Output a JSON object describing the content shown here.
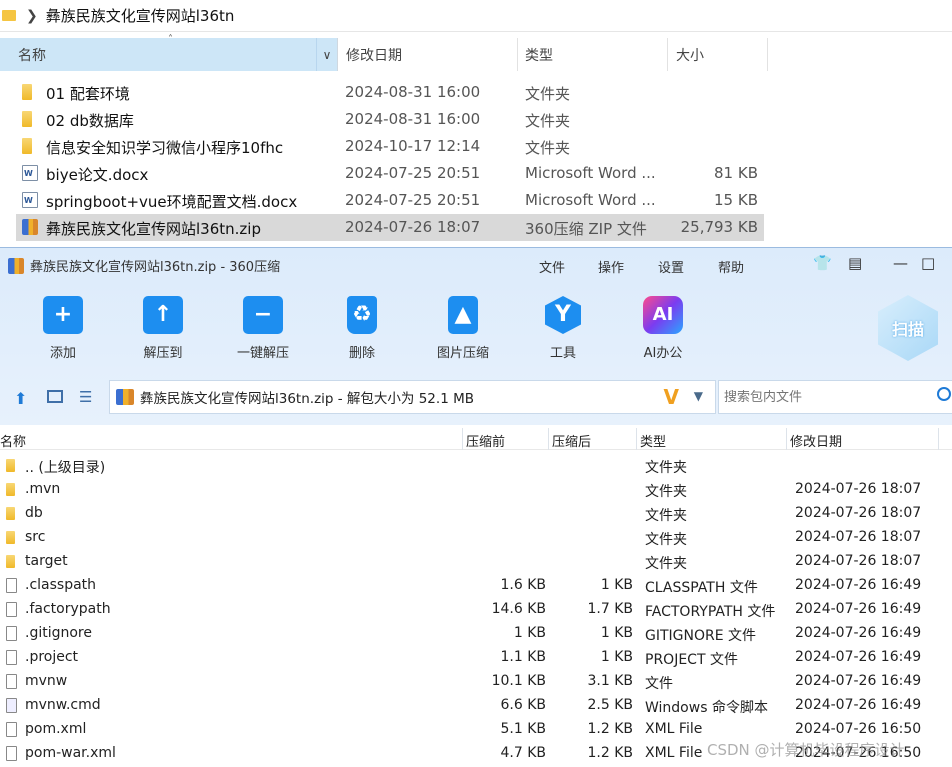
{
  "explorer": {
    "breadcrumb": "彝族民族文化宣传网站l36tn",
    "columns": {
      "name": "名称",
      "date": "修改日期",
      "type": "类型",
      "size": "大小"
    },
    "rows": [
      {
        "name": "01 配套环境",
        "date": "2024-08-31 16:00",
        "type": "文件夹",
        "size": "",
        "icon": "folder-icon"
      },
      {
        "name": "02 db数据库",
        "date": "2024-08-31 16:00",
        "type": "文件夹",
        "size": "",
        "icon": "folder-icon"
      },
      {
        "name": "信息安全知识学习微信小程序10fhc",
        "date": "2024-10-17 12:14",
        "type": "文件夹",
        "size": "",
        "icon": "folder-icon"
      },
      {
        "name": "biye论文.docx",
        "date": "2024-07-25 20:51",
        "type": "Microsoft Word ...",
        "size": "81 KB",
        "icon": "word-doc-icon"
      },
      {
        "name": "springboot+vue环境配置文档.docx",
        "date": "2024-07-25 20:51",
        "type": "Microsoft Word ...",
        "size": "15 KB",
        "icon": "word-doc-icon"
      },
      {
        "name": "彝族民族文化宣传网站l36tn.zip",
        "date": "2024-07-26 18:07",
        "type": "360压缩 ZIP 文件",
        "size": "25,793 KB",
        "icon": "zip-icon",
        "selected": true
      }
    ]
  },
  "zip_window": {
    "title": "彝族民族文化宣传网站l36tn.zip - 360压缩",
    "menu": [
      "文件",
      "操作",
      "设置",
      "帮助"
    ],
    "toolbar": [
      "添加",
      "解压到",
      "一键解压",
      "删除",
      "图片压缩",
      "工具",
      "AI办公"
    ],
    "scan_label": "扫描",
    "address": "彝族民族文化宣传网站l36tn.zip - 解包大小为 52.1 MB",
    "search_placeholder": "搜索包内文件",
    "columns": {
      "name": "名称",
      "compressed": "压缩前",
      "original": "压缩后",
      "type": "类型",
      "date": "修改日期"
    },
    "rows": [
      {
        "name": ".. (上级目录)",
        "cs": "",
        "os": "",
        "type": "文件夹",
        "date": "",
        "icon": "folder-icon"
      },
      {
        "name": ".mvn",
        "cs": "",
        "os": "",
        "type": "文件夹",
        "date": "2024-07-26 18:07",
        "icon": "folder-icon"
      },
      {
        "name": "db",
        "cs": "",
        "os": "",
        "type": "文件夹",
        "date": "2024-07-26 18:07",
        "icon": "folder-icon"
      },
      {
        "name": "src",
        "cs": "",
        "os": "",
        "type": "文件夹",
        "date": "2024-07-26 18:07",
        "icon": "folder-icon"
      },
      {
        "name": "target",
        "cs": "",
        "os": "",
        "type": "文件夹",
        "date": "2024-07-26 18:07",
        "icon": "folder-icon"
      },
      {
        "name": ".classpath",
        "cs": "1.6 KB",
        "os": "1 KB",
        "type": "CLASSPATH 文件",
        "date": "2024-07-26 16:49",
        "icon": "file-icon"
      },
      {
        "name": ".factorypath",
        "cs": "14.6 KB",
        "os": "1.7 KB",
        "type": "FACTORYPATH 文件",
        "date": "2024-07-26 16:49",
        "icon": "file-icon"
      },
      {
        "name": ".gitignore",
        "cs": "1 KB",
        "os": "1 KB",
        "type": "GITIGNORE 文件",
        "date": "2024-07-26 16:49",
        "icon": "file-icon"
      },
      {
        "name": ".project",
        "cs": "1.1 KB",
        "os": "1 KB",
        "type": "PROJECT 文件",
        "date": "2024-07-26 16:49",
        "icon": "file-icon"
      },
      {
        "name": "mvnw",
        "cs": "10.1 KB",
        "os": "3.1 KB",
        "type": "文件",
        "date": "2024-07-26 16:49",
        "icon": "file-icon"
      },
      {
        "name": "mvnw.cmd",
        "cs": "6.6 KB",
        "os": "2.5 KB",
        "type": "Windows 命令脚本",
        "date": "2024-07-26 16:49",
        "icon": "cmd-file-icon"
      },
      {
        "name": "pom.xml",
        "cs": "5.1 KB",
        "os": "1.2 KB",
        "type": "XML File",
        "date": "2024-07-26 16:50",
        "icon": "file-icon"
      },
      {
        "name": "pom-war.xml",
        "cs": "4.7 KB",
        "os": "1.2 KB",
        "type": "XML File",
        "date": "2024-07-26 16:50",
        "icon": "file-icon"
      }
    ]
  },
  "watermark": "CSDN @计算机毕设程序设计"
}
